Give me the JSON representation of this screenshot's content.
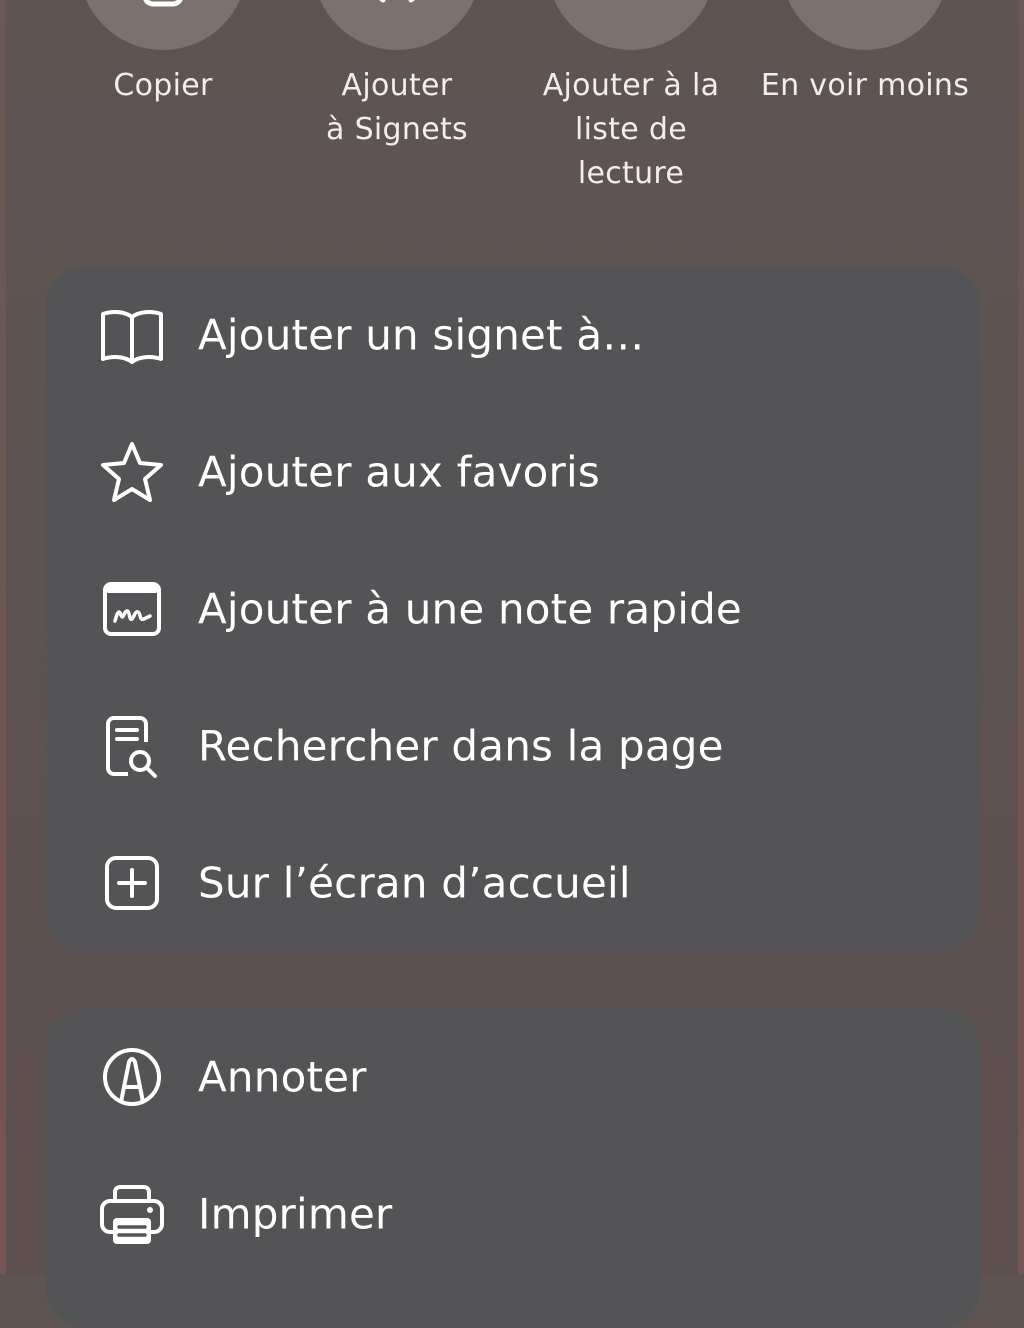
{
  "actions": [
    {
      "label": "Copier",
      "icon": "copy-icon"
    },
    {
      "label": "Ajouter\nà Signets",
      "icon": "bookmark-add-icon"
    },
    {
      "label": "Ajouter à la\nliste de\nlecture",
      "icon": "reading-list-icon"
    },
    {
      "label": "En voir moins",
      "icon": "see-less-icon"
    }
  ],
  "menu_primary": [
    {
      "label": "Ajouter un signet à…",
      "icon": "book-icon"
    },
    {
      "label": "Ajouter aux favoris",
      "icon": "star-icon"
    },
    {
      "label": "Ajouter à une note rapide",
      "icon": "quick-note-icon"
    },
    {
      "label": "Rechercher dans la page",
      "icon": "find-in-page-icon"
    },
    {
      "label": "Sur l’écran d’accueil",
      "icon": "add-square-icon"
    }
  ],
  "menu_secondary": [
    {
      "label": "Annoter",
      "icon": "markup-icon"
    },
    {
      "label": "Imprimer",
      "icon": "printer-icon"
    }
  ],
  "colors": {
    "background": "#5e5553",
    "card": "#545456",
    "action_circle": "#7b726f",
    "text": "#ffffff"
  }
}
